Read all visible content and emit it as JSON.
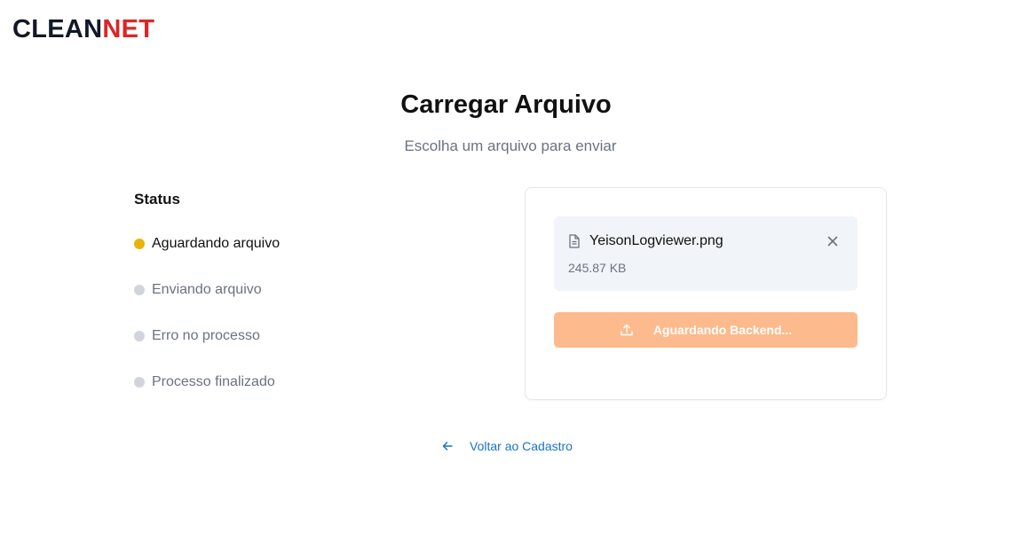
{
  "brand": {
    "part1": "CLEAN",
    "part2": "NET",
    "color_dark": "#111827",
    "color_red": "#dc2626"
  },
  "header": {
    "title": "Carregar Arquivo",
    "subtitle": "Escolha um arquivo para enviar"
  },
  "status": {
    "title": "Status",
    "items": [
      {
        "label": "Aguardando arquivo",
        "state": "active",
        "color": "#eab308"
      },
      {
        "label": "Enviando arquivo",
        "state": "inactive",
        "color": "#d1d5db"
      },
      {
        "label": "Erro no processo",
        "state": "inactive",
        "color": "#d1d5db"
      },
      {
        "label": "Processo finalizado",
        "state": "inactive",
        "color": "#d1d5db"
      }
    ]
  },
  "upload": {
    "file_name": "YeisonLogviewer.png",
    "file_size": "245.87 KB",
    "file_icon": "file-icon",
    "remove_icon": "close-icon",
    "button_label": "Aguardando Backend...",
    "button_icon": "upload-icon",
    "button_color": "#fdba8c"
  },
  "footer": {
    "back_label": "Voltar ao Cadastro",
    "back_icon": "arrow-left-icon",
    "link_color": "#1a73c9"
  }
}
